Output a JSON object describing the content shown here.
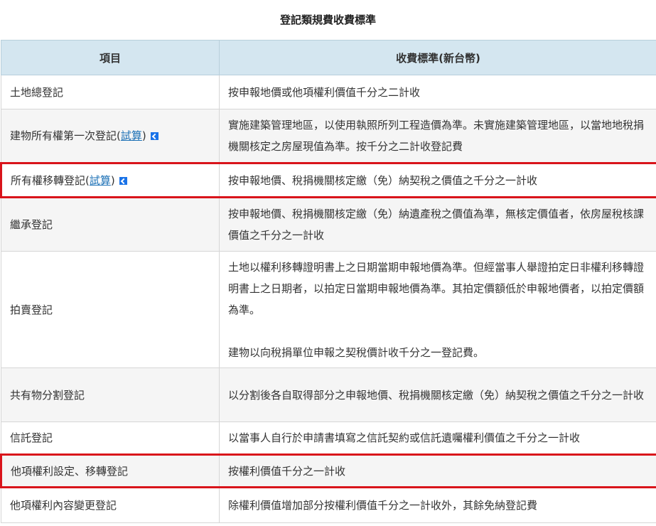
{
  "caption": "登記類規費收費標準",
  "headers": {
    "item": "項目",
    "fee": "收費標準(新台幣)"
  },
  "calc_link": "試算",
  "rows": [
    {
      "item": "土地總登記",
      "fee": "按申報地價或他項權利價值千分之二計收"
    },
    {
      "item": "建物所有權第一次登記",
      "fee": "實施建築管理地區，以使用執照所列工程造價為準。未實施建築管理地區，以當地地稅捐機關核定之房屋現值為準。按千分之二計收登記費"
    },
    {
      "item": "所有權移轉登記",
      "fee": "按申報地價、稅捐機關核定繳（免）納契稅之價值之千分之一計收"
    },
    {
      "item": "繼承登記",
      "fee": "按申報地價、稅捐機關核定繳（免）納遺產稅之價值為準，無核定價值者，依房屋稅核課價值之千分之一計收"
    },
    {
      "item": "拍賣登記",
      "fee": "土地以權利移轉證明書上之日期當期申報地價為準。但經當事人舉證拍定日非權利移轉證明書上之日期者，以拍定日當期申報地價為準。其拍定價額低於申報地價者，以拍定價額為準。",
      "fee2": "建物以向稅捐單位申報之契稅價計收千分之一登記費。"
    },
    {
      "item": "共有物分割登記",
      "fee": "以分割後各自取得部分之申報地價、稅捐機關核定繳（免）納契稅之價值之千分之一計收"
    },
    {
      "item": "信託登記",
      "fee": "以當事人自行於申請書填寫之信託契約或信託遺囑權利價值之千分之一計收"
    },
    {
      "item": "他項權利設定、移轉登記",
      "fee": "按權利價值千分之一計收"
    },
    {
      "item": "他項權利內容變更登記",
      "fee": "除權利價值增加部分按權利價值千分之一計收外，其餘免納登記費"
    }
  ]
}
